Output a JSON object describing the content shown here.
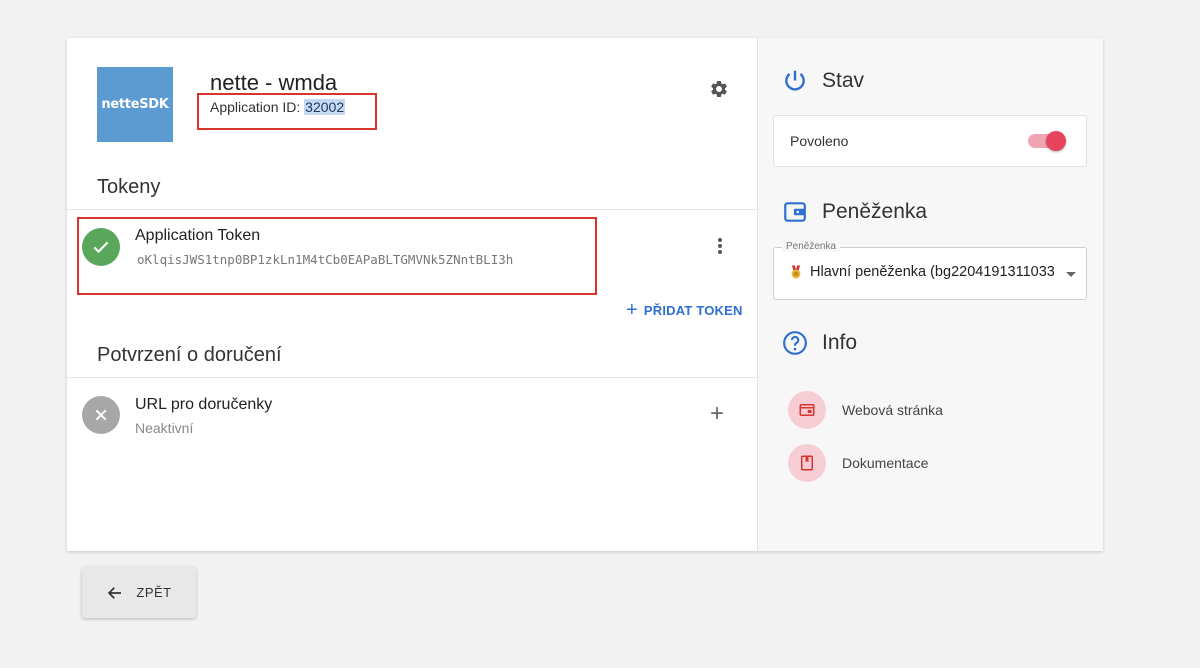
{
  "app": {
    "logo_text": "netteSDK",
    "name": "nette - wmda",
    "id_label": "Application ID: ",
    "id_value": "32002"
  },
  "tokens": {
    "title": "Tokeny",
    "item_title": "Application Token",
    "token_value": "oKlqisJWS1tnp0BP1zkLn1M4tCb0EAPaBLTGMVNk5ZNntBLI3h",
    "add_label": "PŘIDAT TOKEN"
  },
  "delivery": {
    "title": "Potvrzení o doručení",
    "item_title": "URL pro doručenky",
    "item_status": "Neaktivní"
  },
  "status": {
    "title": "Stav",
    "toggle_label": "Povoleno",
    "enabled": true
  },
  "wallet": {
    "title": "Peněženka",
    "field_label": "Peněženka",
    "selected": "Hlavní peněženka (bg2204191311033"
  },
  "info": {
    "title": "Info",
    "links": [
      {
        "label": "Webová stránka",
        "icon": "web-icon"
      },
      {
        "label": "Dokumentace",
        "icon": "book-icon"
      }
    ]
  },
  "back_label": "ZPĚT",
  "colors": {
    "accent_blue": "#2f6fd1",
    "toggle_on": "#e8435c",
    "success": "#5aa65a",
    "highlight_box": "#d9342b"
  }
}
